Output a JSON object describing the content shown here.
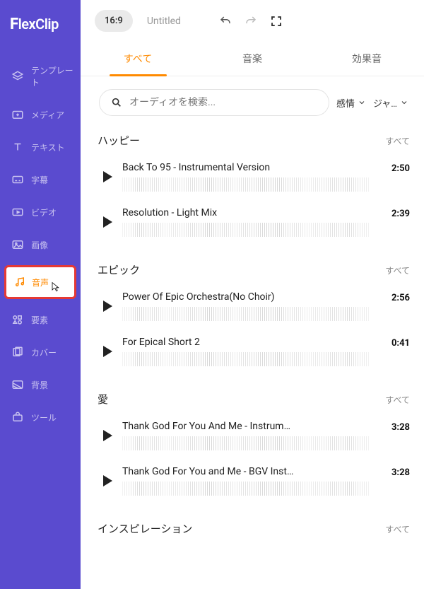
{
  "logo": "FlexClip",
  "topbar": {
    "ratio": "16:9",
    "title": "Untitled"
  },
  "sidebar": {
    "items": [
      {
        "label": "テンプレート"
      },
      {
        "label": "メディア"
      },
      {
        "label": "テキスト"
      },
      {
        "label": "字幕"
      },
      {
        "label": "ビデオ"
      },
      {
        "label": "画像"
      },
      {
        "label": "音声"
      },
      {
        "label": "要素"
      },
      {
        "label": "カバー"
      },
      {
        "label": "背景"
      },
      {
        "label": "ツール"
      }
    ]
  },
  "tabs": {
    "all": "すべて",
    "music": "音楽",
    "sfx": "効果音"
  },
  "search": {
    "placeholder": "オーディオを検索..."
  },
  "filters": {
    "emotion": "感情",
    "genre": "ジャ…"
  },
  "all_label": "すべて",
  "sections": [
    {
      "title": "ハッピー",
      "tracks": [
        {
          "title": "Back To 95 - Instrumental Version",
          "dur": "2:50"
        },
        {
          "title": "Resolution - Light Mix",
          "dur": "2:39"
        }
      ]
    },
    {
      "title": "エピック",
      "tracks": [
        {
          "title": "Power Of Epic Orchestra(No Choir)",
          "dur": "2:56"
        },
        {
          "title": "For Epical Short 2",
          "dur": "0:41"
        }
      ]
    },
    {
      "title": "愛",
      "tracks": [
        {
          "title": "Thank God For You And Me - Instrum…",
          "dur": "3:28"
        },
        {
          "title": "Thank God For You and Me - BGV Inst…",
          "dur": "3:28"
        }
      ]
    },
    {
      "title": "インスピレーション",
      "tracks": []
    }
  ]
}
